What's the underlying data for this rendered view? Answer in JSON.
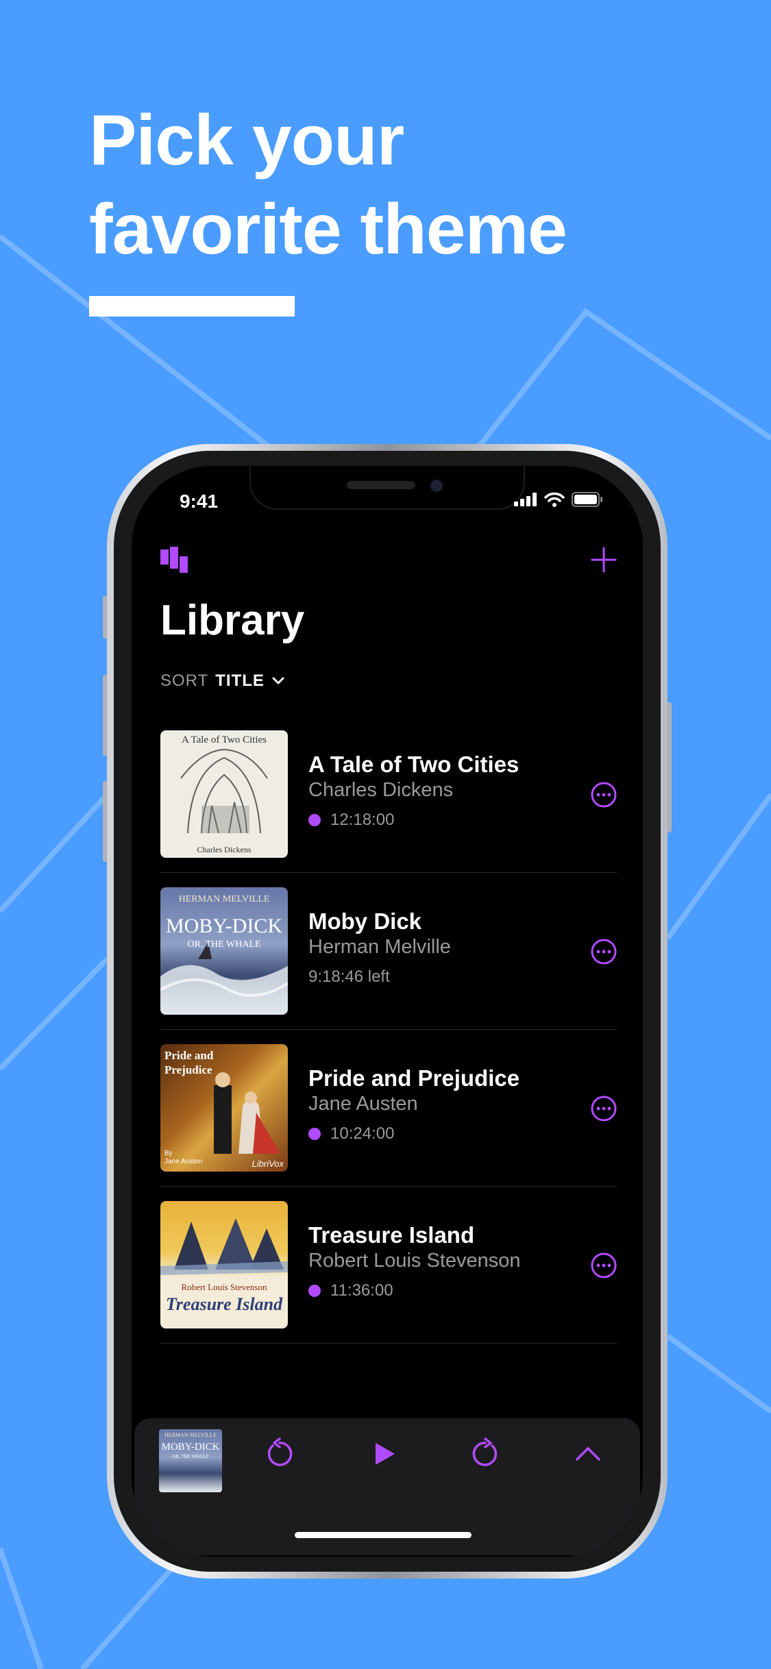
{
  "headline": {
    "line1": "Pick your",
    "line2": "favorite theme"
  },
  "status": {
    "time": "9:41"
  },
  "library": {
    "title": "Library",
    "sort_label": "SORT",
    "sort_value": "TITLE",
    "books": [
      {
        "title": "A Tale of Two Cities",
        "author": "Charles Dickens",
        "meta": "12:18:00",
        "new_dot": true,
        "cover_text": [
          "A Tale of Two Cities",
          "Charles Dickens"
        ]
      },
      {
        "title": "Moby Dick",
        "author": "Herman Melville",
        "meta": "9:18:46 left",
        "new_dot": false,
        "cover_text": [
          "HERMAN MELVILLE",
          "MOBY-DICK",
          "OR, THE WHALE"
        ]
      },
      {
        "title": "Pride and Prejudice",
        "author": "Jane Austen",
        "meta": "10:24:00",
        "new_dot": true,
        "cover_text": [
          "Pride and",
          "Prejudice",
          "By",
          "Jane Austen",
          "LibriVox"
        ]
      },
      {
        "title": "Treasure Island",
        "author": "Robert Louis Stevenson",
        "meta": "11:36:00",
        "new_dot": true,
        "cover_text": [
          "Robert Louis Stevenson",
          "Treasure Island"
        ]
      }
    ]
  },
  "player": {
    "cover_text": [
      "HERMAN MELVILLE",
      "MOBY-DICK",
      "OR, THE WHALE"
    ]
  },
  "colors": {
    "background": "#4a9cff",
    "accent": "#b04bff",
    "screen": "#000000",
    "player_bg": "#1c1c1e"
  }
}
